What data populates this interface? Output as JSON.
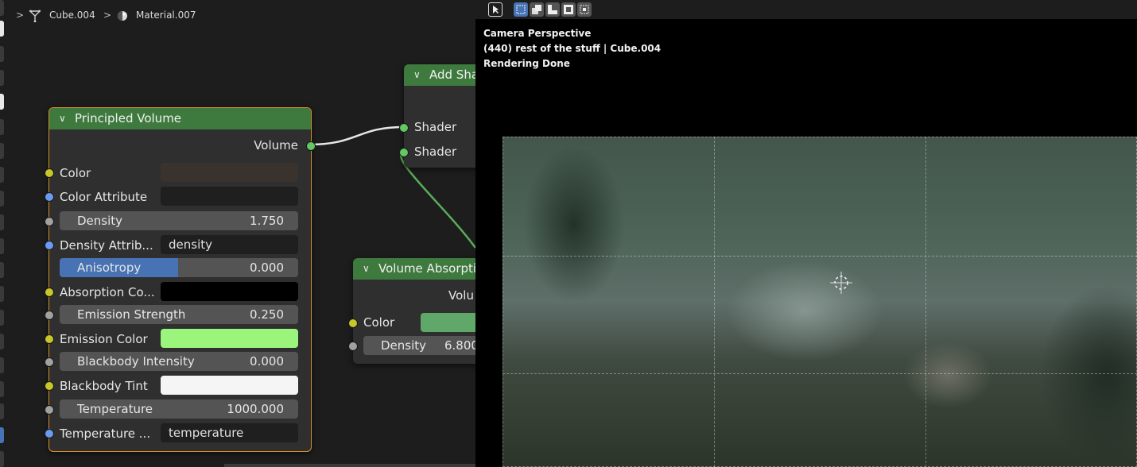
{
  "breadcrumb": {
    "object": "Cube.004",
    "material": "Material.007"
  },
  "principled_volume": {
    "title": "Principled Volume",
    "output": "Volume",
    "rows": {
      "color": "Color",
      "color_attribute": "Color Attribute",
      "density_label": "Density",
      "density_value": "1.750",
      "density_attribute": "Density Attrib...",
      "density_attribute_value": "density",
      "anisotropy_label": "Anisotropy",
      "anisotropy_value": "0.000",
      "absorption_color": "Absorption Co...",
      "emission_strength_label": "Emission Strength",
      "emission_strength_value": "0.250",
      "emission_color": "Emission Color",
      "blackbody_intensity_label": "Blackbody Intensity",
      "blackbody_intensity_value": "0.000",
      "blackbody_tint": "Blackbody Tint",
      "temperature_label": "Temperature",
      "temperature_value": "1000.000",
      "temperature_attribute": "Temperature ...",
      "temperature_attribute_value": "temperature"
    },
    "colors": {
      "color": "#3a332d",
      "absorption": "#000000",
      "emission": "#9bf57c",
      "blackbody_tint": "#f5f5f5"
    }
  },
  "add_shader": {
    "title": "Add Sha",
    "input1": "Shader",
    "input2": "Shader"
  },
  "volume_absorption": {
    "title": "Volume Absorptio",
    "output": "Volu",
    "color_label": "Color",
    "density_label": "Density",
    "density_value": "6.800",
    "color_swatch": "#5fa86a"
  },
  "viewport": {
    "line1": "Camera Perspective",
    "line2": "(440) rest of the stuff | Cube.004",
    "line3": "Rendering Done"
  },
  "accent": {
    "node_header": "#3e7a3e",
    "selection_blue": "#4772b3",
    "node_border_active": "#d6902b"
  }
}
